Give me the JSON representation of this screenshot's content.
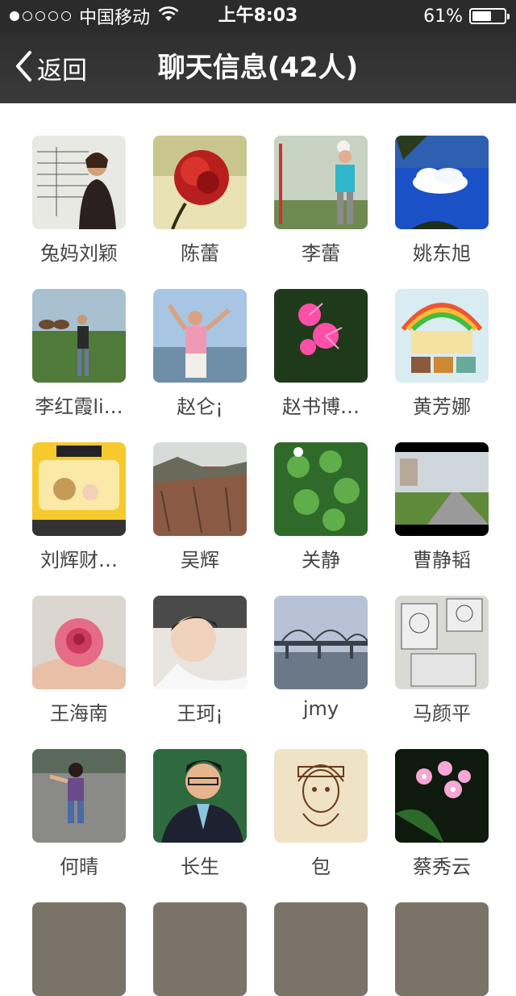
{
  "status_bar": {
    "signal_dots": 5,
    "signal_filled": 1,
    "carrier": "中国移动",
    "time": "上午8:03",
    "battery_text": "61%",
    "battery_level": 0.61
  },
  "nav": {
    "back_label": "返回",
    "title": "聊天信息(42人)"
  },
  "members": [
    {
      "name": "兔妈刘颖",
      "avatar_icon": "whiteboard-photo"
    },
    {
      "name": "陈蕾",
      "avatar_icon": "red-rose-photo"
    },
    {
      "name": "李蕾",
      "avatar_icon": "woman-outdoor-photo"
    },
    {
      "name": "姚东旭",
      "avatar_icon": "blue-sky-cloud-photo"
    },
    {
      "name": "李红霞li…",
      "avatar_icon": "grassland-camels-photo"
    },
    {
      "name": "赵仑¡",
      "avatar_icon": "beach-man-photo"
    },
    {
      "name": "赵书博…",
      "avatar_icon": "pink-flower-photo"
    },
    {
      "name": "黄芳娜",
      "avatar_icon": "paper-artist-photo"
    },
    {
      "name": "刘辉财…",
      "avatar_icon": "school-bus-photo"
    },
    {
      "name": "吴辉",
      "avatar_icon": "cliff-photo"
    },
    {
      "name": "关静",
      "avatar_icon": "clover-photo"
    },
    {
      "name": "曹静韬",
      "avatar_icon": "street-photo"
    },
    {
      "name": "王海南",
      "avatar_icon": "rose-in-hands-photo"
    },
    {
      "name": "王珂¡",
      "avatar_icon": "sleeping-baby-photo"
    },
    {
      "name": "jmy",
      "avatar_icon": "bridge-photo"
    },
    {
      "name": "马颜平",
      "avatar_icon": "sketch-photo"
    },
    {
      "name": "何晴",
      "avatar_icon": "child-walking-photo"
    },
    {
      "name": "长生",
      "avatar_icon": "man-portrait-photo"
    },
    {
      "name": "包",
      "avatar_icon": "girl-drawing-photo"
    },
    {
      "name": "蔡秀云",
      "avatar_icon": "pink-blossoms-photo"
    },
    {
      "name": "",
      "avatar_icon": "partial-photo"
    },
    {
      "name": "",
      "avatar_icon": "partial-photo"
    },
    {
      "name": "",
      "avatar_icon": "partial-photo"
    },
    {
      "name": "",
      "avatar_icon": "partial-photo"
    }
  ]
}
